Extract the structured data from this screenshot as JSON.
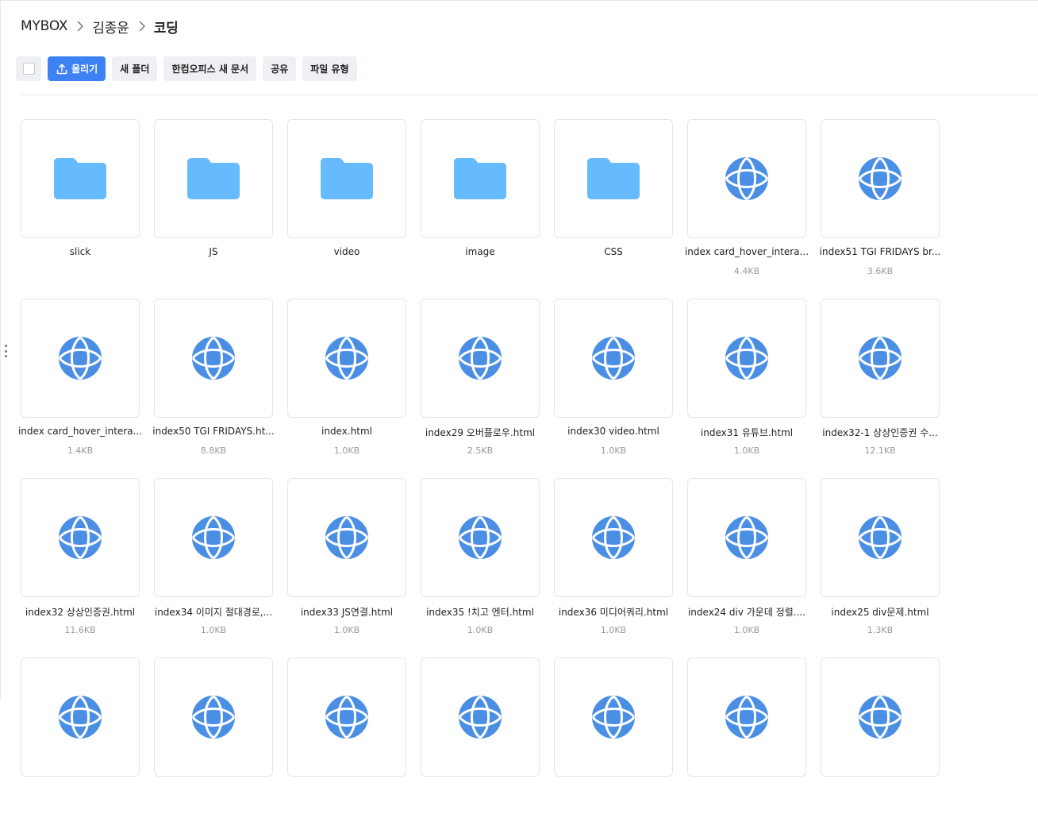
{
  "breadcrumb": {
    "root": "MYBOX",
    "parent": "김종윤",
    "current": "코딩"
  },
  "toolbar": {
    "upload": "올리기",
    "new_folder": "새 폴더",
    "hancom_new_doc": "한컴오피스 새 문서",
    "share": "공유",
    "file_type": "파일 유형"
  },
  "colors": {
    "accent": "#3d82f5",
    "folder": "#66bbff",
    "web_icon": "#4a8fe4"
  },
  "files": [
    {
      "name": "slick",
      "size": "",
      "kind": "folder"
    },
    {
      "name": "JS",
      "size": "",
      "kind": "folder"
    },
    {
      "name": "video",
      "size": "",
      "kind": "folder"
    },
    {
      "name": "image",
      "size": "",
      "kind": "folder"
    },
    {
      "name": "CSS",
      "size": "",
      "kind": "folder"
    },
    {
      "name": "index card_hover_intera...",
      "size": "4.4KB",
      "kind": "web"
    },
    {
      "name": "index51 TGI FRIDAYS br...",
      "size": "3.6KB",
      "kind": "web"
    },
    {
      "name": "index card_hover_intera...",
      "size": "1.4KB",
      "kind": "web"
    },
    {
      "name": "index50 TGI FRIDAYS.ht...",
      "size": "8.8KB",
      "kind": "web"
    },
    {
      "name": "index.html",
      "size": "1.0KB",
      "kind": "web"
    },
    {
      "name": "index29 오버플로우.html",
      "size": "2.5KB",
      "kind": "web"
    },
    {
      "name": "index30 video.html",
      "size": "1.0KB",
      "kind": "web"
    },
    {
      "name": "index31 유튜브.html",
      "size": "1.0KB",
      "kind": "web"
    },
    {
      "name": "index32-1 상상인증권 수...",
      "size": "12.1KB",
      "kind": "web"
    },
    {
      "name": "index32 상상인증권.html",
      "size": "11.6KB",
      "kind": "web"
    },
    {
      "name": "index34 이미지 절대경로,...",
      "size": "1.0KB",
      "kind": "web"
    },
    {
      "name": "index33 JS연결.html",
      "size": "1.0KB",
      "kind": "web"
    },
    {
      "name": "index35 !치고 엔터.html",
      "size": "1.0KB",
      "kind": "web"
    },
    {
      "name": "index36 미디어쿼리.html",
      "size": "1.0KB",
      "kind": "web"
    },
    {
      "name": "index24 div 가운데 정렬....",
      "size": "1.0KB",
      "kind": "web"
    },
    {
      "name": "index25 div문제.html",
      "size": "1.3KB",
      "kind": "web"
    },
    {
      "name": "",
      "size": "",
      "kind": "web"
    },
    {
      "name": "",
      "size": "",
      "kind": "web"
    },
    {
      "name": "",
      "size": "",
      "kind": "web"
    },
    {
      "name": "",
      "size": "",
      "kind": "web"
    },
    {
      "name": "",
      "size": "",
      "kind": "web"
    },
    {
      "name": "",
      "size": "",
      "kind": "web"
    },
    {
      "name": "",
      "size": "",
      "kind": "web"
    }
  ]
}
